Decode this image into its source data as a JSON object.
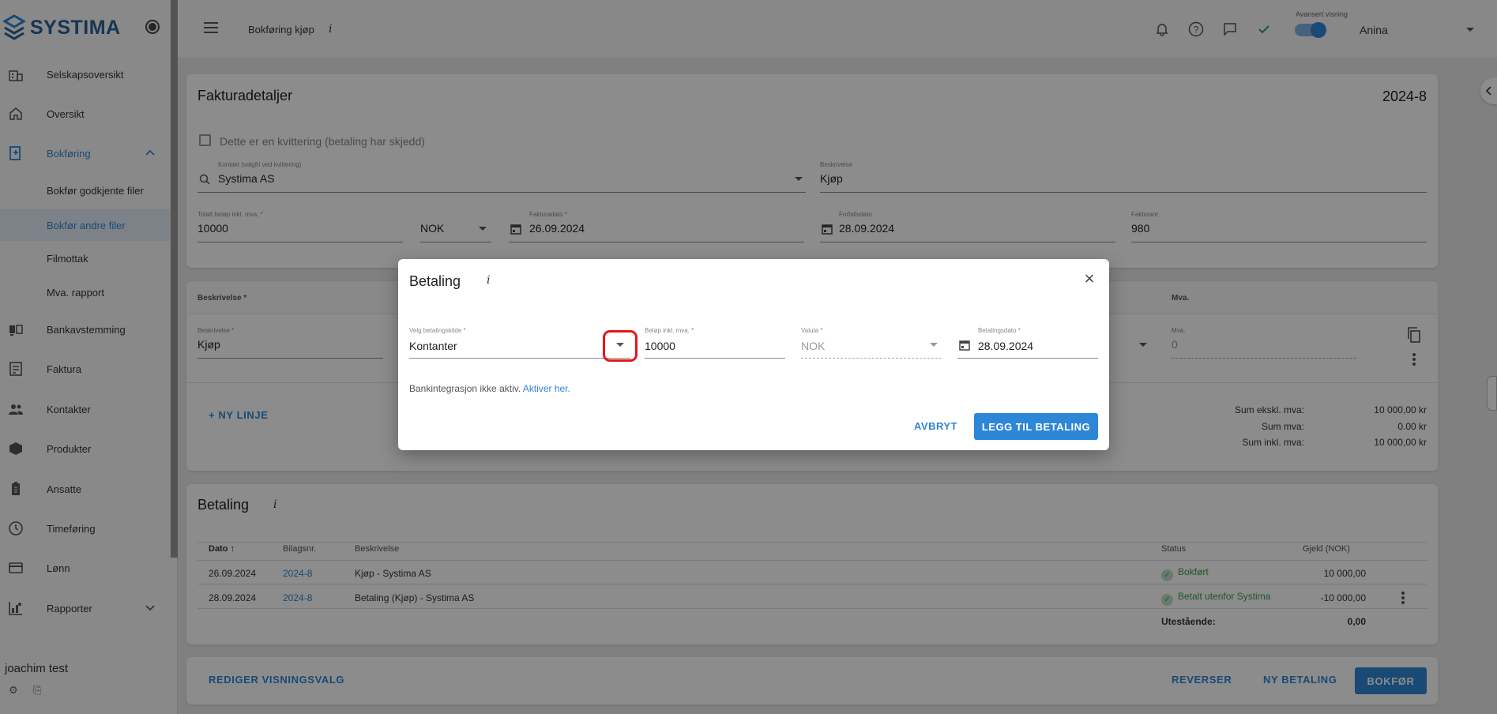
{
  "brand": {
    "name": "SYSTIMA",
    "accent": "#2e86d6",
    "logo_color": "#29629a"
  },
  "sidebar": {
    "items": [
      {
        "label": "Selskapsoversikt",
        "icon": "company-icon"
      },
      {
        "label": "Oversikt",
        "icon": "home-icon"
      },
      {
        "label": "Bokføring",
        "icon": "bookkeeping-icon",
        "active": true
      },
      {
        "label": "Bankavstemming",
        "icon": "bank-icon"
      },
      {
        "label": "Faktura",
        "icon": "invoice-icon"
      },
      {
        "label": "Kontakter",
        "icon": "contacts-icon"
      },
      {
        "label": "Produkter",
        "icon": "products-icon"
      },
      {
        "label": "Ansatte",
        "icon": "employees-icon"
      },
      {
        "label": "Timeføring",
        "icon": "clock-icon"
      },
      {
        "label": "Lønn",
        "icon": "payroll-icon"
      },
      {
        "label": "Rapporter",
        "icon": "reports-icon"
      }
    ],
    "sub_items": [
      {
        "label": "Bokfør godkjente filer"
      },
      {
        "label": "Bokfør andre filer",
        "selected": true
      },
      {
        "label": "Filmottak"
      },
      {
        "label": "Mva. rapport"
      }
    ],
    "user": "joachim test"
  },
  "topbar": {
    "page_title": "Bokføring kjøp",
    "info": "i",
    "advanced_label": "Avansert visning",
    "user": "Anina"
  },
  "invoice": {
    "title": "Fakturadetaljer",
    "number": "2024-8",
    "receipt_checkbox": "Dette er en kvittering (betaling har skjedd)",
    "contact_label": "Kontakt (valgfri ved kvittering)",
    "contact_value": "Systima AS",
    "description_label": "Beskrivelse",
    "description_value": "Kjøp",
    "total_label": "Totalt beløp inkl. mva. *",
    "total_value": "10000",
    "currency_value": "NOK",
    "invoice_date_label": "Fakturadato *",
    "invoice_date_value": "26.09.2024",
    "due_date_label": "Forfallsdato",
    "due_date_value": "28.09.2024",
    "invoice_no_label": "Fakturanr.",
    "invoice_no_value": "980"
  },
  "lines": {
    "col_description": "Beskrivelse *",
    "col_vat": "Mva.",
    "line_desc_label": "Beskrivelse *",
    "line_desc_value": "Kjøp",
    "line_vat_label": "Mva.",
    "line_vat_value": "0",
    "new_line": "+ NY LINJE",
    "sum_excl_label": "Sum ekskl. mva:",
    "sum_excl_value": "10 000,00 kr",
    "sum_vat_label": "Sum mva:",
    "sum_vat_value": "0.00 kr",
    "sum_incl_label": "Sum inkl. mva:",
    "sum_incl_value": "10 000,00 kr"
  },
  "payments": {
    "title": "Betaling",
    "info": "i",
    "headers": {
      "date": "Dato",
      "voucher": "Bilagsnr.",
      "description": "Beskrivelse",
      "status": "Status",
      "debt": "Gjeld (NOK)"
    },
    "rows": [
      {
        "date": "26.09.2024",
        "voucher": "2024-8",
        "description": "Kjøp - Systima AS",
        "status": "Bokført",
        "debt": "10 000,00"
      },
      {
        "date": "28.09.2024",
        "voucher": "2024-8",
        "description": "Betaling (Kjøp) - Systima AS",
        "status": "Betalt utenfor Systima",
        "debt": "-10 000,00"
      }
    ],
    "outstanding_label": "Utestående:",
    "outstanding_value": "0,00"
  },
  "footer": {
    "edit_view": "REDIGER VISNINGSVALG",
    "reverse": "REVERSER",
    "new_payment": "NY BETALING",
    "post": "BOKFØR"
  },
  "dialog": {
    "title": "Betaling",
    "info": "i",
    "source_label": "Velg betalingskilde *",
    "source_value": "Kontanter",
    "amount_label": "Beløp inkl. mva. *",
    "amount_value": "10000",
    "currency_label": "Valuta *",
    "currency_value": "NOK",
    "date_label": "Betalingsdato *",
    "date_value": "28.09.2024",
    "bank_text": "Bankintegrasjon ikke aktiv.",
    "bank_link": "Aktiver her.",
    "cancel": "AVBRYT",
    "add": "LEGG TIL BETALING"
  }
}
